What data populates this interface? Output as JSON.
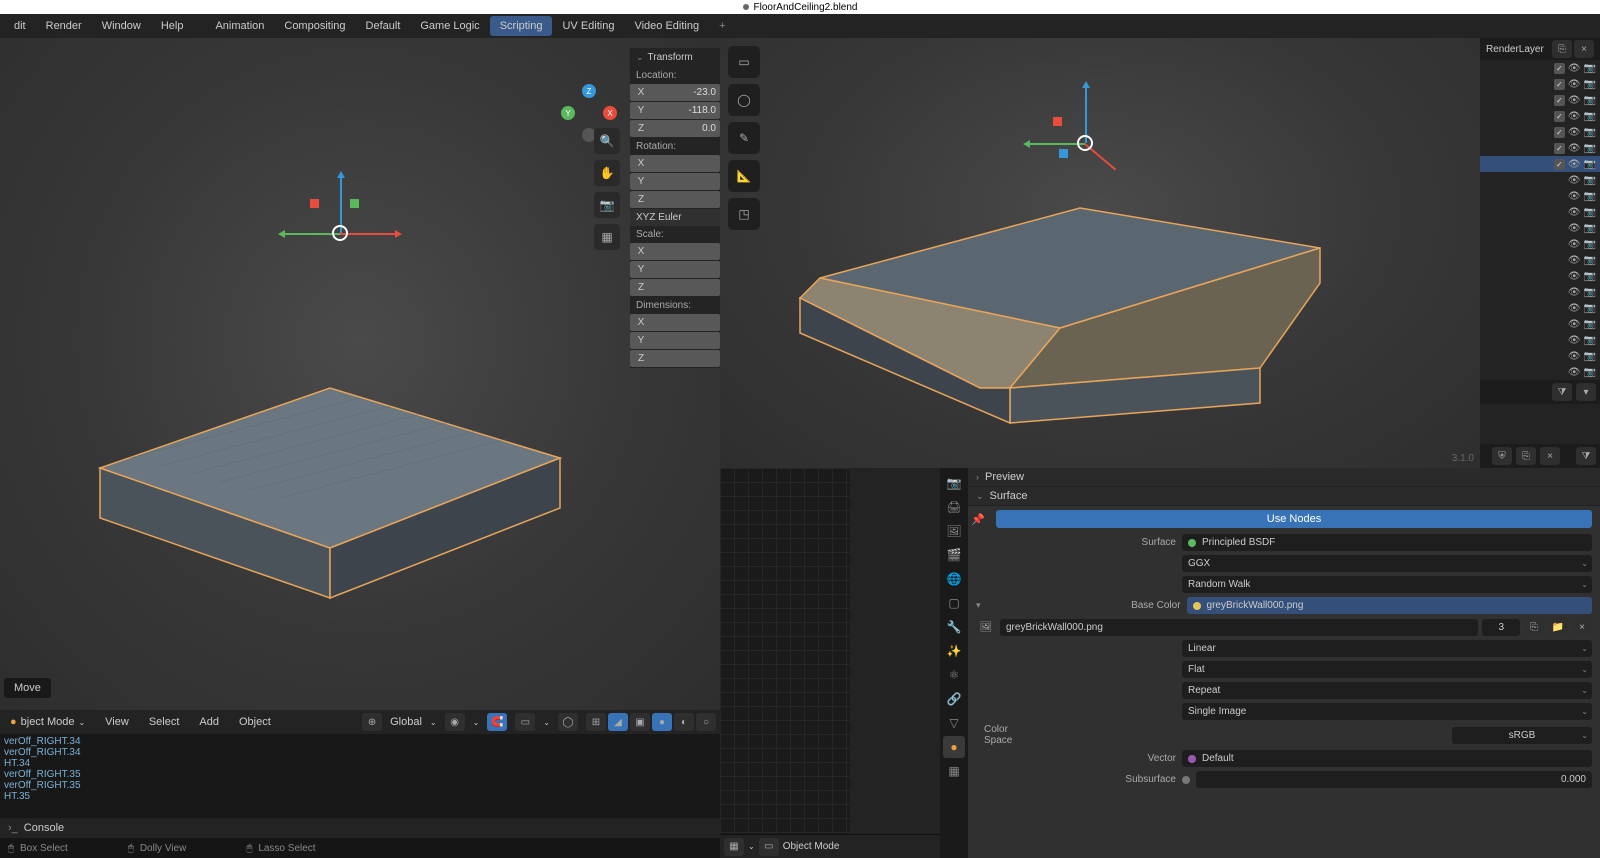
{
  "title": "FloorAndCeiling2.blend",
  "menu": {
    "items": [
      "dit",
      "Render",
      "Window",
      "Help"
    ]
  },
  "workspaces": [
    "Animation",
    "Compositing",
    "Default",
    "Game Logic",
    "Scripting",
    "UV Editing",
    "Video Editing"
  ],
  "active_workspace": "Scripting",
  "transform": {
    "header": "Transform",
    "location_label": "Location:",
    "location": {
      "X": "-23.0",
      "Y": "-118.0",
      "Z": "0.0"
    },
    "rotation_label": "Rotation:",
    "rotation": {
      "X": "",
      "Y": "",
      "Z": ""
    },
    "rotation_mode": "XYZ Euler",
    "scale_label": "Scale:",
    "scale": {
      "X": "",
      "Y": "",
      "Z": ""
    },
    "dimensions_label": "Dimensions:",
    "dimensions": {
      "X": "",
      "Y": "",
      "Z": ""
    }
  },
  "tool_tag": "Move",
  "vp_header": {
    "menu": [
      "View",
      "Select",
      "Add",
      "Object"
    ],
    "orientation": "Global",
    "mode": "Object Mode"
  },
  "console": {
    "lines": [
      "verOff_RIGHT.34",
      "verOff_RIGHT.34",
      "HT.34",
      "verOff_RIGHT.35",
      "verOff_RIGHT.35",
      "HT.35"
    ],
    "header": "Console"
  },
  "status": {
    "a": "Box Select",
    "b": "Dolly View",
    "c": "Lasso Select"
  },
  "right_vp": {
    "mode": "Object Mode"
  },
  "outliner": {
    "header": "RenderLayer",
    "rows_with_checkbox": 7,
    "rows_eye_only": 13
  },
  "properties": {
    "preview": "Preview",
    "surface": "Surface",
    "use_nodes": "Use Nodes",
    "surface_label": "Surface",
    "surface_value": "Principled BSDF",
    "distribution": "GGX",
    "subsurface_method": "Random Walk",
    "basecolor_label": "Base Color",
    "basecolor_value": "greyBrickWall000.png",
    "image_name": "greyBrickWall000.png",
    "image_users": "3",
    "interpolation": "Linear",
    "projection": "Flat",
    "extension": "Repeat",
    "source": "Single Image",
    "colorspace_label": "Color Space",
    "colorspace_value": "sRGB",
    "vector_label": "Vector",
    "vector_value": "Default",
    "subsurface_label": "Subsurface",
    "subsurface_value": "0.000"
  },
  "version": "3.1.0"
}
